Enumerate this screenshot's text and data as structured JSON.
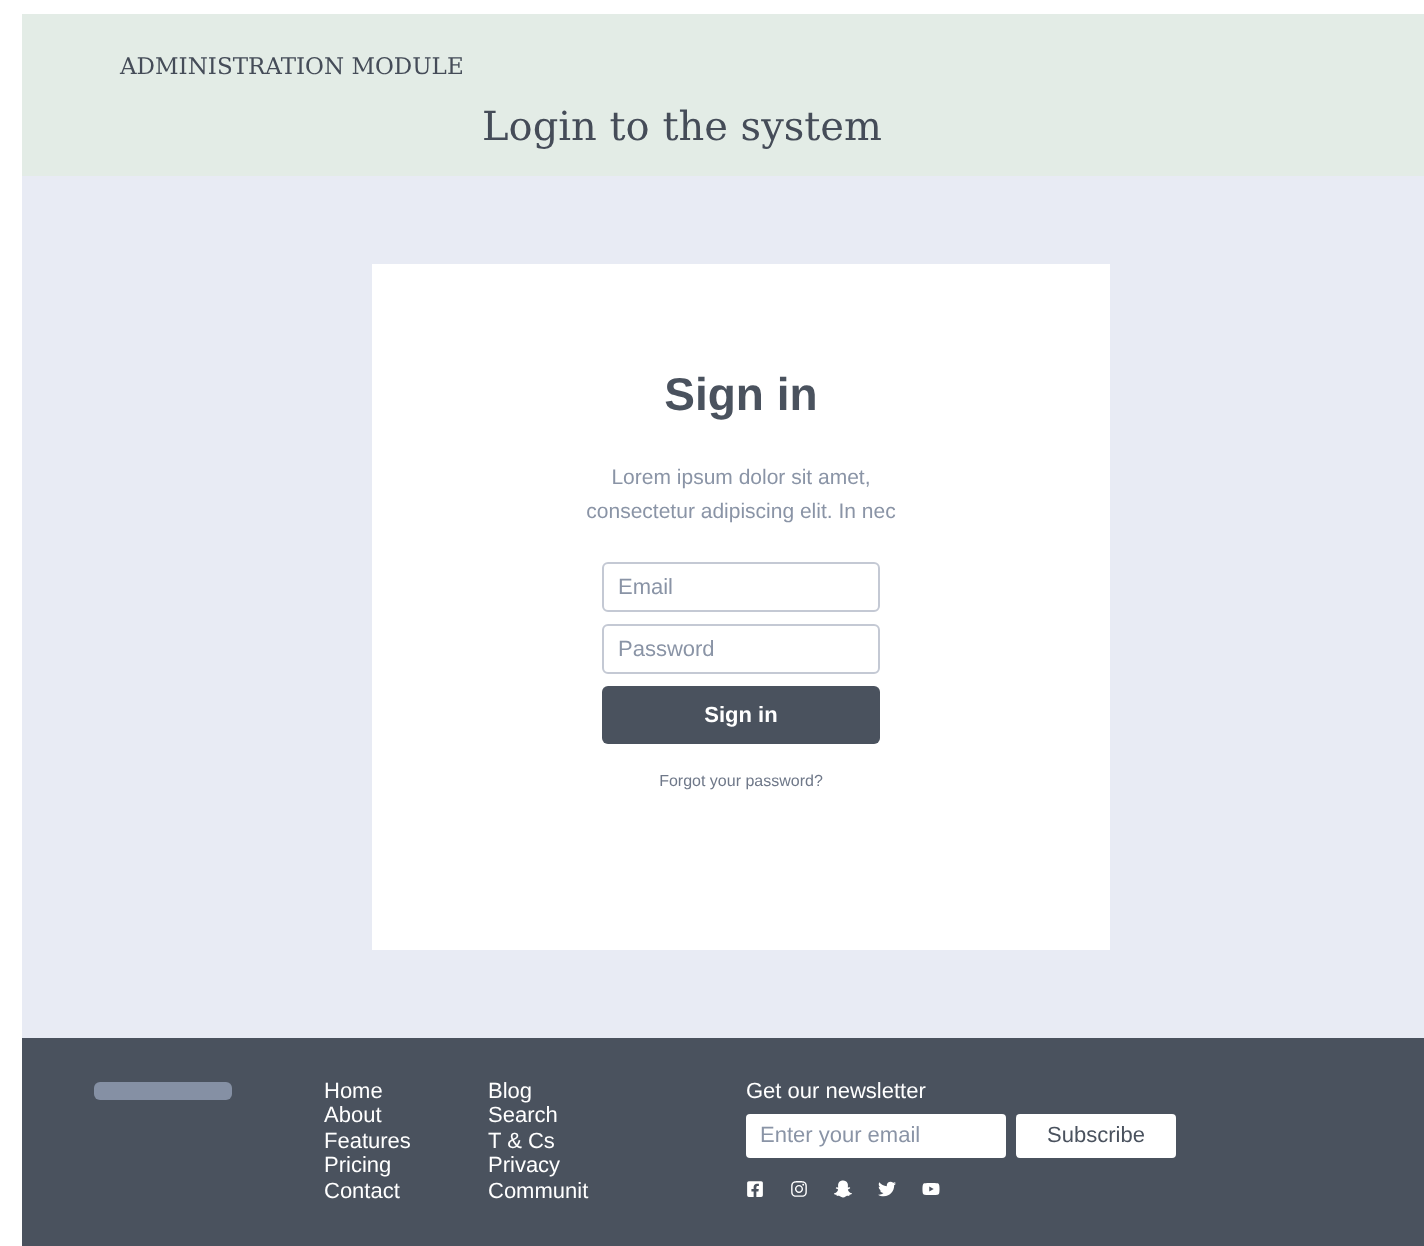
{
  "header": {
    "module": "ADMINISTRATION MODULE",
    "title": "Login to the system"
  },
  "card": {
    "title": "Sign in",
    "description": "Lorem ipsum dolor sit amet, consectetur adipiscing elit. In nec",
    "fields": [
      {
        "placeholder": "Email"
      },
      {
        "placeholder": "Password"
      }
    ],
    "button": "Sign in",
    "link": "Forgot your password?"
  },
  "footer": {
    "columns": [
      [
        "Home",
        "About",
        "Features",
        "Pricing",
        "Contact"
      ],
      [
        "Blog",
        "Search",
        "T & Cs",
        "Privacy",
        "Communit"
      ]
    ],
    "newsletter": {
      "title": "Get our newsletter",
      "placeholder": "Enter your email",
      "button": "Subscribe"
    },
    "social": [
      {
        "kind": "facebook"
      },
      {
        "kind": "instagram"
      },
      {
        "kind": "snapchat"
      },
      {
        "kind": "twitter"
      },
      {
        "kind": "youtube"
      }
    ]
  }
}
